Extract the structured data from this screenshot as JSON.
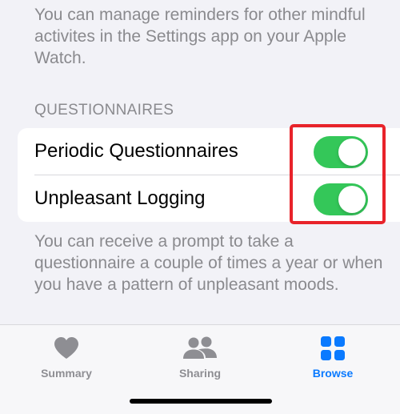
{
  "top_note": "You can manage reminders for other mindful activites in the Settings app on your Apple Watch.",
  "questionnaires": {
    "header": "QUESTIONNAIRES",
    "rows": [
      {
        "label": "Periodic Questionnaires",
        "toggle_on": true
      },
      {
        "label": "Unpleasant Logging",
        "toggle_on": true
      }
    ],
    "footnote": "You can receive a prompt to take a questionnaire a couple of times a year or when you have a pattern of unpleasant moods."
  },
  "tabbar": {
    "tabs": [
      {
        "label": "Summary",
        "icon": "heart-icon",
        "selected": false
      },
      {
        "label": "Sharing",
        "icon": "people-icon",
        "selected": false
      },
      {
        "label": "Browse",
        "icon": "grid-icon",
        "selected": true
      }
    ]
  },
  "colors": {
    "toggle_on": "#34c759",
    "accent": "#0a7aff",
    "highlight": "#e8232a",
    "secondary_text": "#8a8a8e",
    "background": "#f2f2f7"
  }
}
